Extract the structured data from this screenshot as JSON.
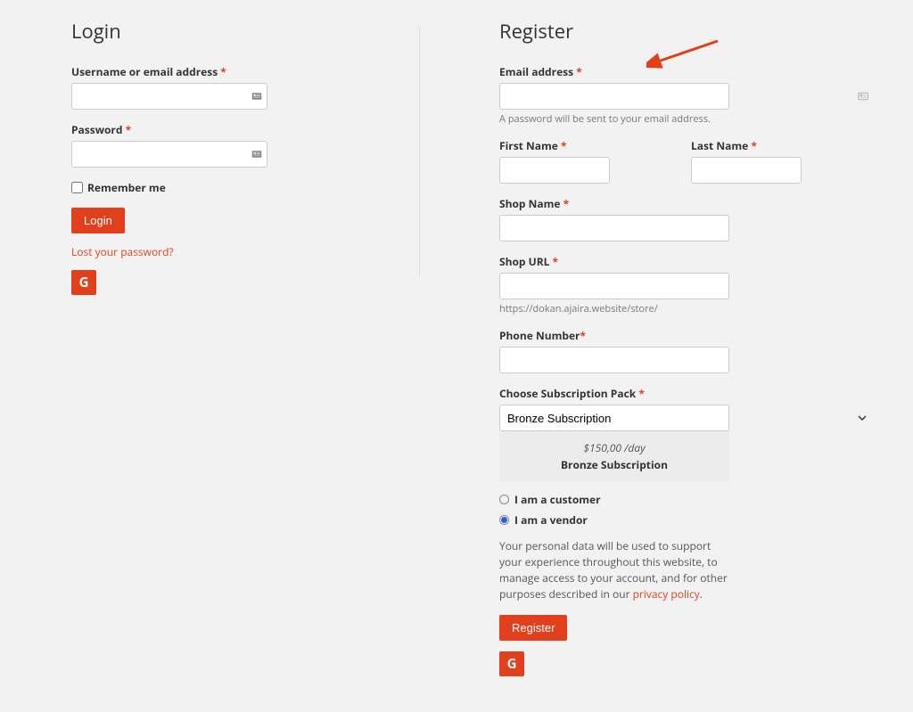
{
  "login": {
    "heading": "Login",
    "username_label": "Username or email address",
    "password_label": "Password",
    "remember_label": "Remember me",
    "login_button": "Login",
    "lost_password_link": "Lost your password?"
  },
  "register": {
    "heading": "Register",
    "email_label": "Email address",
    "password_hint": "A password will be sent to your email address.",
    "first_name_label": "First Name",
    "last_name_label": "Last Name",
    "shop_name_label": "Shop Name",
    "shop_url_label": "Shop URL",
    "shop_url_prefix": "https://dokan.ajaira.website/store/",
    "phone_label": "Phone Number",
    "subscription_label": "Choose Subscription Pack",
    "subscription_selected": "Bronze Subscription",
    "subscription_price": "$150,00 /day",
    "subscription_name": "Bronze Subscription",
    "role_customer": "I am a customer",
    "role_vendor": "I am a vendor",
    "privacy_text": "Your personal data will be used to support your experience throughout this website, to manage access to your account, and for other purposes described in our ",
    "privacy_link": "privacy policy",
    "register_button": "Register"
  },
  "icons": {
    "google": "G"
  }
}
